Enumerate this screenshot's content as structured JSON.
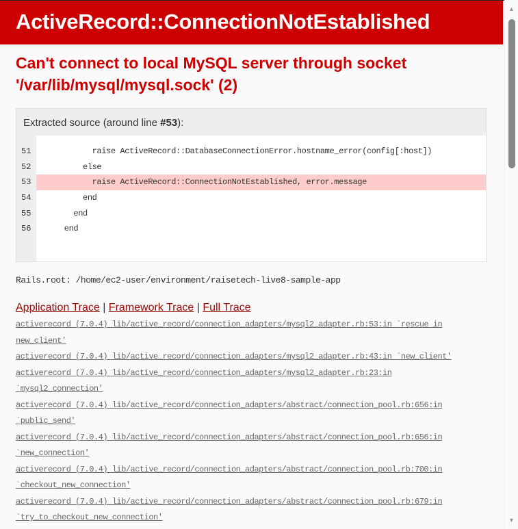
{
  "header": {
    "title": "ActiveRecord::ConnectionNotEstablished"
  },
  "message": "Can't connect to local MySQL server through socket '/var/lib/mysql/mysql.sock' (2)",
  "source": {
    "heading_prefix": "Extracted source (around line ",
    "heading_line": "#53",
    "heading_suffix": "):",
    "lines": [
      {
        "num": "51",
        "code": "            raise ActiveRecord::DatabaseConnectionError.hostname_error(config[:host])",
        "highlight": false
      },
      {
        "num": "52",
        "code": "          else",
        "highlight": false
      },
      {
        "num": "53",
        "code": "            raise ActiveRecord::ConnectionNotEstablished, error.message",
        "highlight": true
      },
      {
        "num": "54",
        "code": "          end",
        "highlight": false
      },
      {
        "num": "55",
        "code": "        end",
        "highlight": false
      },
      {
        "num": "56",
        "code": "      end",
        "highlight": false
      }
    ]
  },
  "rails_root": "Rails.root: /home/ec2-user/environment/raisetech-live8-sample-app",
  "trace_tabs": {
    "application": "Application Trace",
    "framework": "Framework Trace",
    "full": "Full Trace",
    "sep": "|"
  },
  "trace": [
    "activerecord (7.0.4) lib/active_record/connection_adapters/mysql2_adapter.rb:53:in `rescue in new_client'",
    "activerecord (7.0.4) lib/active_record/connection_adapters/mysql2_adapter.rb:43:in `new_client'",
    "activerecord (7.0.4) lib/active_record/connection_adapters/mysql2_adapter.rb:23:in `mysql2_connection'",
    "activerecord (7.0.4) lib/active_record/connection_adapters/abstract/connection_pool.rb:656:in `public_send'",
    "activerecord (7.0.4) lib/active_record/connection_adapters/abstract/connection_pool.rb:656:in `new_connection'",
    "activerecord (7.0.4) lib/active_record/connection_adapters/abstract/connection_pool.rb:700:in `checkout_new_connection'",
    "activerecord (7.0.4) lib/active_record/connection_adapters/abstract/connection_pool.rb:679:in `try_to_checkout_new_connection'"
  ]
}
